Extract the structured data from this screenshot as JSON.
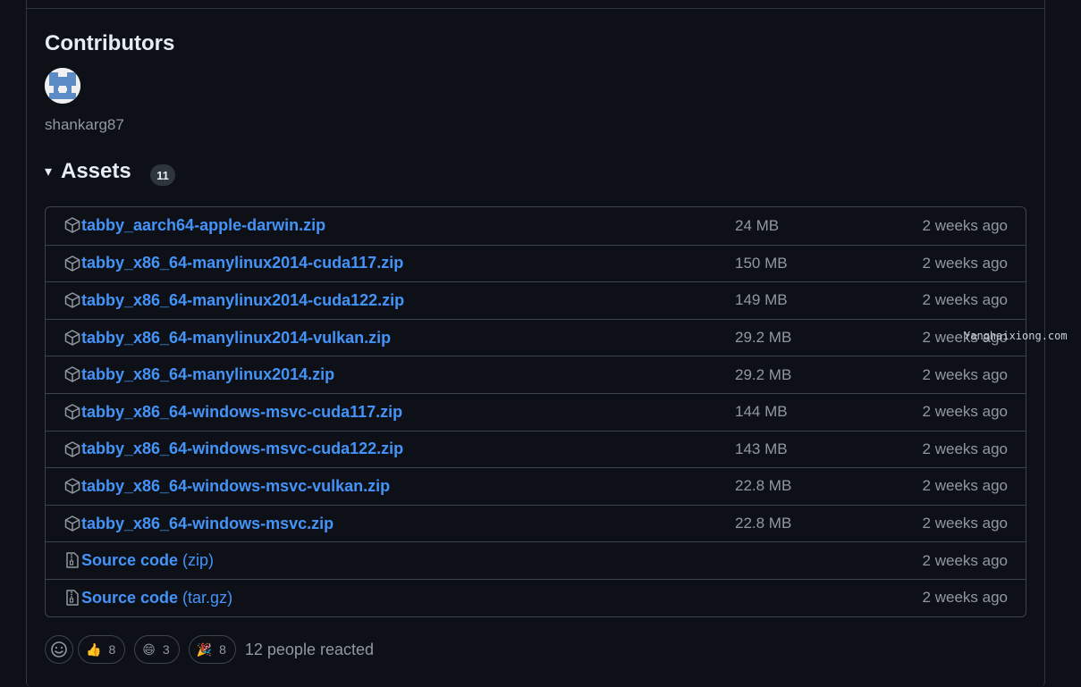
{
  "contributors": {
    "title": "Contributors",
    "users": [
      {
        "name": "shankarg87"
      }
    ]
  },
  "assets": {
    "title": "Assets",
    "count": "11",
    "caret": "▾",
    "items": [
      {
        "name": "tabby_aarch64-apple-darwin.zip",
        "suffix": "",
        "size": "24 MB",
        "date": "2 weeks ago",
        "icon": "package-icon"
      },
      {
        "name": "tabby_x86_64-manylinux2014-cuda117.zip",
        "suffix": "",
        "size": "150 MB",
        "date": "2 weeks ago",
        "icon": "package-icon"
      },
      {
        "name": "tabby_x86_64-manylinux2014-cuda122.zip",
        "suffix": "",
        "size": "149 MB",
        "date": "2 weeks ago",
        "icon": "package-icon"
      },
      {
        "name": "tabby_x86_64-manylinux2014-vulkan.zip",
        "suffix": "",
        "size": "29.2 MB",
        "date": "2 weeks ago",
        "icon": "package-icon"
      },
      {
        "name": "tabby_x86_64-manylinux2014.zip",
        "suffix": "",
        "size": "29.2 MB",
        "date": "2 weeks ago",
        "icon": "package-icon"
      },
      {
        "name": "tabby_x86_64-windows-msvc-cuda117.zip",
        "suffix": "",
        "size": "144 MB",
        "date": "2 weeks ago",
        "icon": "package-icon"
      },
      {
        "name": "tabby_x86_64-windows-msvc-cuda122.zip",
        "suffix": "",
        "size": "143 MB",
        "date": "2 weeks ago",
        "icon": "package-icon"
      },
      {
        "name": "tabby_x86_64-windows-msvc-vulkan.zip",
        "suffix": "",
        "size": "22.8 MB",
        "date": "2 weeks ago",
        "icon": "package-icon"
      },
      {
        "name": "tabby_x86_64-windows-msvc.zip",
        "suffix": "",
        "size": "22.8 MB",
        "date": "2 weeks ago",
        "icon": "package-icon"
      },
      {
        "name": "Source code",
        "suffix": " (zip)",
        "size": "",
        "date": "2 weeks ago",
        "icon": "file-zip-icon"
      },
      {
        "name": "Source code",
        "suffix": " (tar.gz)",
        "size": "",
        "date": "2 weeks ago",
        "icon": "file-zip-icon"
      }
    ]
  },
  "watermark": "Yanghaixiong.com",
  "reactions": {
    "items": [
      {
        "emoji": "👍",
        "count": "8",
        "name": "thumbs-up"
      },
      {
        "emoji": "😄",
        "count": "3",
        "name": "smile"
      },
      {
        "emoji": "🎉",
        "count": "8",
        "name": "hooray"
      }
    ],
    "summary": "12 people reacted"
  },
  "colors": {
    "background": "#0d1117",
    "link": "#4493f8",
    "muted": "#9198a1",
    "border": "#3d444d"
  }
}
